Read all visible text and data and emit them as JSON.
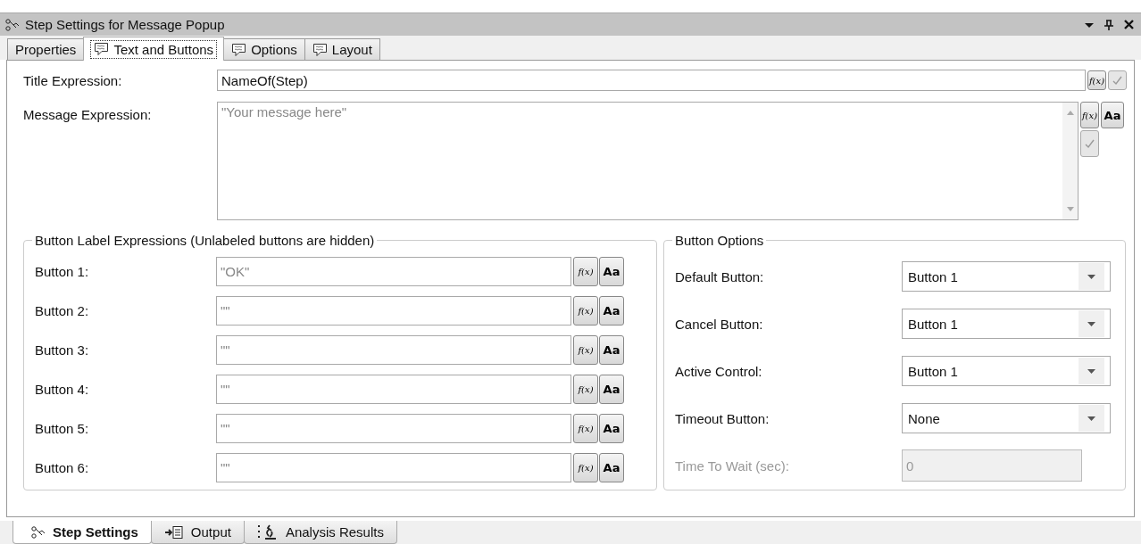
{
  "window": {
    "title": "Step Settings for Message Popup"
  },
  "tabs": [
    {
      "label": "Properties",
      "selected": false
    },
    {
      "label": "Text and Buttons",
      "selected": true
    },
    {
      "label": "Options",
      "selected": false
    },
    {
      "label": "Layout",
      "selected": false
    }
  ],
  "title_expression": {
    "label": "Title Expression:",
    "value": "NameOf(Step)",
    "buttons": [
      {
        "kind": "fx",
        "label": "f(x)",
        "disabled": false
      },
      {
        "kind": "check",
        "disabled": true
      }
    ]
  },
  "message_expression": {
    "label": "Message Expression:",
    "placeholder": "\"Your message here\"",
    "buttons": [
      {
        "kind": "fx",
        "label": "f(x)",
        "disabled": false
      },
      {
        "kind": "font",
        "label": "Aa",
        "disabled": false
      },
      {
        "kind": "check",
        "disabled": true
      }
    ]
  },
  "button_labels": {
    "title": "Button Label Expressions (Unlabeled buttons are hidden)",
    "rows": [
      {
        "label": "Button 1:",
        "placeholder": "\"OK\"",
        "buttons": [
          {
            "kind": "fx",
            "label": "f(x)"
          },
          {
            "kind": "font",
            "label": "Aa"
          }
        ]
      },
      {
        "label": "Button 2:",
        "placeholder": "\"\"",
        "buttons": [
          {
            "kind": "fx",
            "label": "f(x)"
          },
          {
            "kind": "font",
            "label": "Aa"
          }
        ]
      },
      {
        "label": "Button 3:",
        "placeholder": "\"\"",
        "buttons": [
          {
            "kind": "fx",
            "label": "f(x)"
          },
          {
            "kind": "font",
            "label": "Aa"
          }
        ]
      },
      {
        "label": "Button 4:",
        "placeholder": "\"\"",
        "buttons": [
          {
            "kind": "fx",
            "label": "f(x)"
          },
          {
            "kind": "font",
            "label": "Aa"
          }
        ]
      },
      {
        "label": "Button 5:",
        "placeholder": "\"\"",
        "buttons": [
          {
            "kind": "fx",
            "label": "f(x)"
          },
          {
            "kind": "font",
            "label": "Aa"
          }
        ]
      },
      {
        "label": "Button 6:",
        "placeholder": "\"\"",
        "buttons": [
          {
            "kind": "fx",
            "label": "f(x)"
          },
          {
            "kind": "font",
            "label": "Aa"
          }
        ]
      }
    ]
  },
  "button_options": {
    "title": "Button Options",
    "rows": [
      {
        "kind": "dropdown",
        "label": "Default Button:",
        "value": "Button 1",
        "disabled": false
      },
      {
        "kind": "dropdown",
        "label": "Cancel Button:",
        "value": "Button 1",
        "disabled": false
      },
      {
        "kind": "dropdown",
        "label": "Active Control:",
        "value": "Button 1",
        "disabled": false
      },
      {
        "kind": "dropdown",
        "label": "Timeout Button:",
        "value": "None",
        "disabled": false
      },
      {
        "kind": "text",
        "label": "Time To Wait (sec):",
        "value": "0",
        "disabled": true
      }
    ]
  },
  "bottom_tabs": [
    {
      "label": "Step Settings",
      "selected": true
    },
    {
      "label": "Output",
      "selected": false
    },
    {
      "label": "Analysis Results",
      "selected": false
    }
  ]
}
